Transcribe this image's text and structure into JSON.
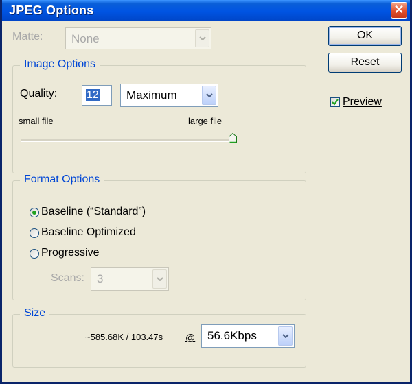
{
  "window": {
    "title": "JPEG Options"
  },
  "buttons": {
    "ok": "OK",
    "reset": "Reset",
    "close": "✕"
  },
  "preview": {
    "label": "Preview",
    "checked": true
  },
  "matte": {
    "label": "Matte:",
    "value": "None"
  },
  "image_options": {
    "title": "Image Options",
    "quality_label": "Quality:",
    "quality_value": "12",
    "quality_preset": "Maximum",
    "small_label": "small file",
    "large_label": "large file",
    "slider_fraction": 1.0
  },
  "format_options": {
    "title": "Format Options",
    "options": [
      "Baseline (“Standard”)",
      "Baseline Optimized",
      "Progressive"
    ],
    "selected": 0,
    "scans_label": "Scans:",
    "scans_value": "3"
  },
  "size": {
    "title": "Size",
    "estimate": "~585.68K / 103.47s",
    "at_symbol": "@",
    "speed": "56.6Kbps"
  },
  "colors": {
    "title_bar": "#0054e3",
    "group_title": "#0046d5",
    "dialog_bg": "#ece9d8",
    "radio_dot": "#21a121"
  }
}
